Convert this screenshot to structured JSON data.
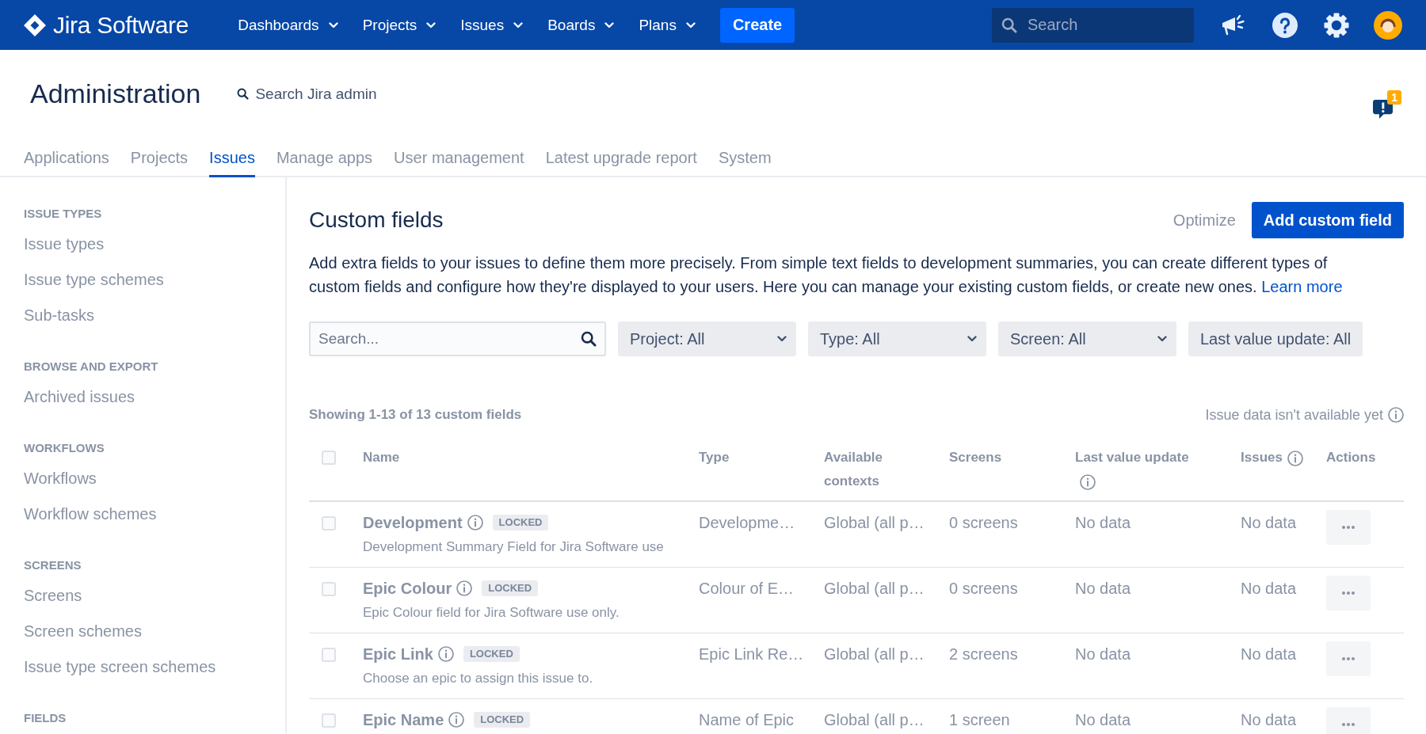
{
  "top_nav": {
    "product": "Jira Software",
    "menus": [
      {
        "label": "Dashboards"
      },
      {
        "label": "Projects"
      },
      {
        "label": "Issues"
      },
      {
        "label": "Boards"
      },
      {
        "label": "Plans"
      }
    ],
    "create_button": "Create",
    "search": {
      "placeholder": "Search"
    }
  },
  "header": {
    "title": "Administration",
    "admin_search": "Search Jira admin",
    "feedback_badge": "1"
  },
  "tabs": [
    {
      "label": "Applications",
      "selected": false
    },
    {
      "label": "Projects",
      "selected": false
    },
    {
      "label": "Issues",
      "selected": true
    },
    {
      "label": "Manage apps",
      "selected": false
    },
    {
      "label": "User management",
      "selected": false
    },
    {
      "label": "Latest upgrade report",
      "selected": false
    },
    {
      "label": "System",
      "selected": false
    }
  ],
  "sidebar": {
    "sections": [
      {
        "heading": "ISSUE TYPES",
        "disabled": true,
        "items": [
          "Issue types",
          "Issue type schemes",
          "Sub-tasks"
        ]
      },
      {
        "heading": "BROWSE AND EXPORT",
        "disabled": true,
        "items": [
          "Archived issues"
        ]
      },
      {
        "heading": "WORKFLOWS",
        "disabled": true,
        "items": [
          "Workflows",
          "Workflow schemes"
        ]
      },
      {
        "heading": "SCREENS",
        "disabled": true,
        "items": [
          "Screens",
          "Screen schemes",
          "Issue type screen schemes"
        ]
      },
      {
        "heading": "FIELDS",
        "disabled": true
      }
    ]
  },
  "page": {
    "title": "Custom fields",
    "optimize_button": {
      "label": "Optimize",
      "disabled": true
    },
    "add_button": "Add custom field",
    "description": "Add extra fields to your issues to define them more precisely. From simple text fields to development summaries, you can create different types of custom fields and configure how they're displayed to your users. Here you can manage your existing custom fields, or create new ones.",
    "learn_more": "Learn more"
  },
  "filters": {
    "search": {
      "placeholder": "Search..."
    },
    "dropdowns": [
      {
        "label": "Project: All",
        "kind": "select"
      },
      {
        "label": "Type: All",
        "kind": "select"
      },
      {
        "label": "Screen: All",
        "kind": "select"
      },
      {
        "label": "Last value update: All",
        "kind": "button"
      }
    ]
  },
  "table": {
    "disabled": true,
    "summary": "Showing 1-13 of 13 custom fields",
    "data_notice": "Issue data isn't available yet",
    "select_all": {
      "checked": false
    },
    "columns": [
      {
        "label": "Name",
        "info": false
      },
      {
        "label": "Type",
        "info": false
      },
      {
        "label": "Available contexts",
        "info": false
      },
      {
        "label": "Screens",
        "info": false
      },
      {
        "label": "Last value update",
        "info": true
      },
      {
        "label": "Issues",
        "info": true
      },
      {
        "label": "Actions",
        "info": false
      }
    ],
    "rows": [
      {
        "checked": false,
        "name": "Development",
        "badge": "LOCKED",
        "description": "Development Summary Field for Jira Software use",
        "type": "Developme…",
        "contexts": "Global (all p…",
        "screens": "0 screens",
        "last_value_update": "No data",
        "issues": "No data"
      },
      {
        "checked": false,
        "name": "Epic Colour",
        "badge": "LOCKED",
        "description": "Epic Colour field for Jira Software use only.",
        "type": "Colour of E…",
        "contexts": "Global (all p…",
        "screens": "0 screens",
        "last_value_update": "No data",
        "issues": "No data"
      },
      {
        "checked": false,
        "name": "Epic Link",
        "badge": "LOCKED",
        "description": "Choose an epic to assign this issue to.",
        "type": "Epic Link Re…",
        "contexts": "Global (all p…",
        "screens": "2 screens",
        "last_value_update": "No data",
        "issues": "No data"
      },
      {
        "checked": false,
        "name": "Epic Name",
        "badge": "LOCKED",
        "type": "Name of Epic",
        "contexts": "Global (all p…",
        "screens": "1 screen",
        "last_value_update": "No data",
        "issues": "No data"
      }
    ]
  }
}
